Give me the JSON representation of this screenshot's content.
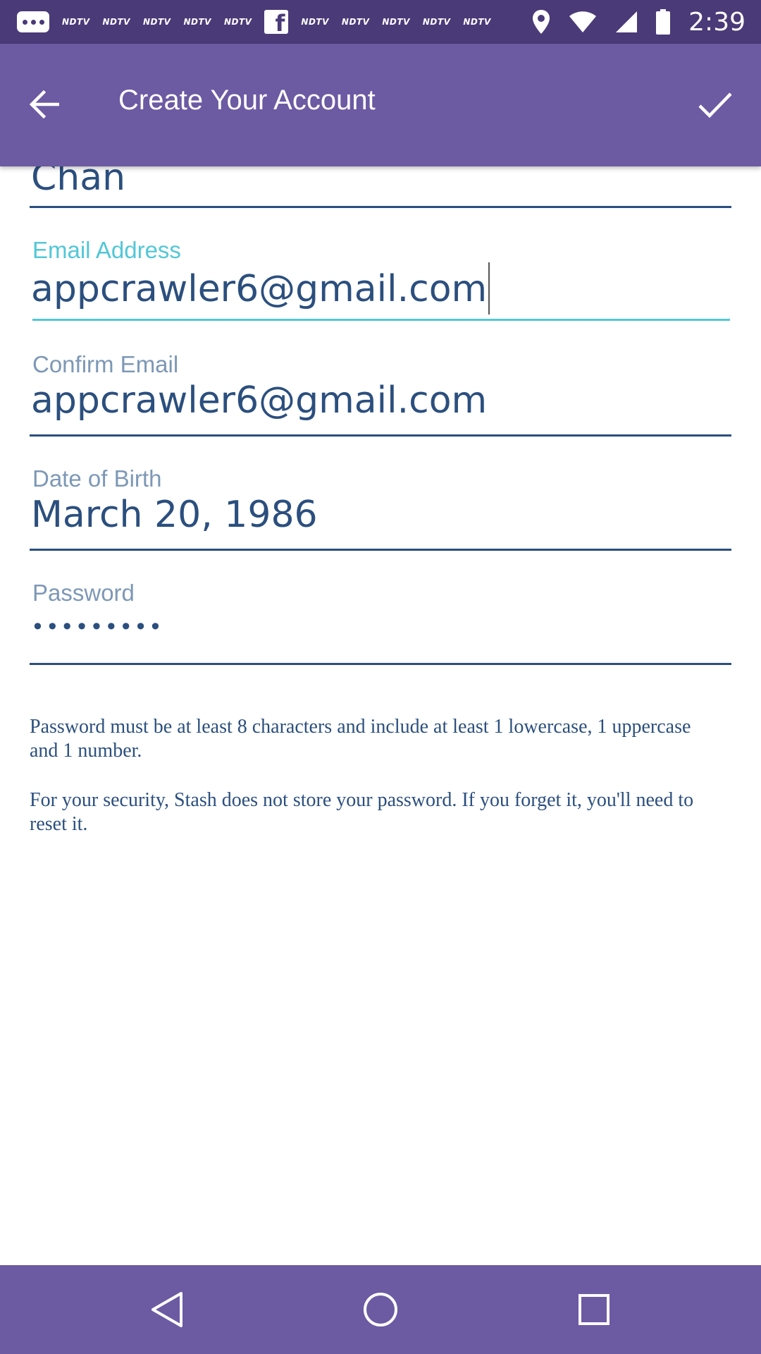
{
  "status_bar": {
    "time": "2:39",
    "notification_labels": [
      "NDTV",
      "NDTV",
      "NDTV",
      "NDTV",
      "NDTV",
      "NDTV",
      "NDTV",
      "NDTV",
      "NDTV",
      "NDTV"
    ],
    "icons": [
      "chat-bubble-icon",
      "facebook-icon",
      "location-pin-icon",
      "wifi-icon",
      "signal-icon",
      "battery-icon"
    ]
  },
  "app_bar": {
    "title": "Create Your Account",
    "back_icon": "arrow-left-icon",
    "done_icon": "check-icon"
  },
  "form": {
    "last_name": {
      "value": "Chan"
    },
    "email": {
      "label": "Email Address",
      "value": "appcrawler6@gmail.com"
    },
    "confirm_email": {
      "label": "Confirm Email",
      "value": "appcrawler6@gmail.com"
    },
    "dob": {
      "label": "Date of Birth",
      "value": "March 20, 1986"
    },
    "password": {
      "label": "Password",
      "masked_value": "•••••••••"
    }
  },
  "info": {
    "requirements": "Password must be at least 8 characters and include at least 1 lowercase, 1 uppercase and 1 number.",
    "security": "For your security, Stash does not store your password. If you forget it, you'll need to reset it."
  },
  "nav_bar": {
    "icons": [
      "back-triangle-icon",
      "home-circle-icon",
      "recents-square-icon"
    ]
  },
  "colors": {
    "status_bar": "#4a3a78",
    "app_bar": "#6c5aa3",
    "text_primary": "#2b4f7e",
    "label": "#7d98b6",
    "accent": "#52c7d6"
  }
}
